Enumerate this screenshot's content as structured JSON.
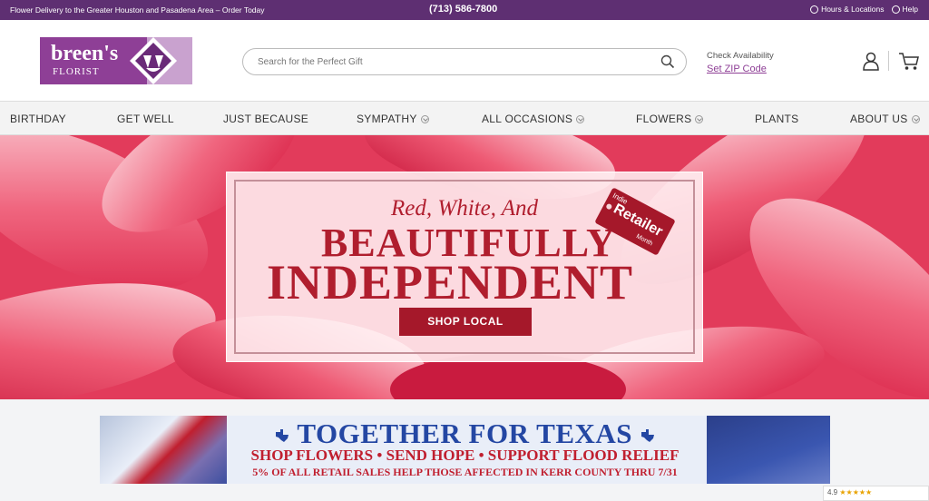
{
  "topbar": {
    "message": "Flower Delivery to the Greater Houston and Pasadena Area – Order Today",
    "phone": "(713) 586-7800",
    "hours_label": "Hours & Locations",
    "help_label": "Help"
  },
  "header": {
    "logo_name": "breen's",
    "logo_sub": "FLORIST",
    "search_placeholder": "Search for the Perfect Gift",
    "zip_prompt": "Check Availability",
    "zip_link": "Set ZIP Code"
  },
  "nav": {
    "items": [
      {
        "label": "BIRTHDAY",
        "has_menu": false
      },
      {
        "label": "GET WELL",
        "has_menu": false
      },
      {
        "label": "JUST BECAUSE",
        "has_menu": false
      },
      {
        "label": "SYMPATHY",
        "has_menu": true
      },
      {
        "label": "ALL OCCASIONS",
        "has_menu": true
      },
      {
        "label": "FLOWERS",
        "has_menu": true
      },
      {
        "label": "PLANTS",
        "has_menu": false
      },
      {
        "label": "ABOUT US",
        "has_menu": true
      }
    ]
  },
  "hero": {
    "line1": "Red, White, And",
    "line2": "BEAUTIFULLY",
    "line3": "INDEPENDENT",
    "tag_top": "Indie",
    "tag_main": "Retailer",
    "tag_bottom": "Month",
    "button_label": "SHOP LOCAL"
  },
  "banner": {
    "title": "TOGETHER FOR TEXAS",
    "subtitle": "SHOP FLOWERS • SEND HOPE • SUPPORT FLOOD RELIEF",
    "note": "5% OF ALL RETAIL SALES HELP THOSE AFFECTED IN KERR COUNTY THRU 7/31"
  },
  "rating": {
    "score": "4.9",
    "stars": "★★★★★"
  },
  "colors": {
    "brand_purple": "#5e2f72",
    "logo_purple": "#8e3f96",
    "hero_red": "#a5182a",
    "banner_blue": "#2447a3"
  }
}
